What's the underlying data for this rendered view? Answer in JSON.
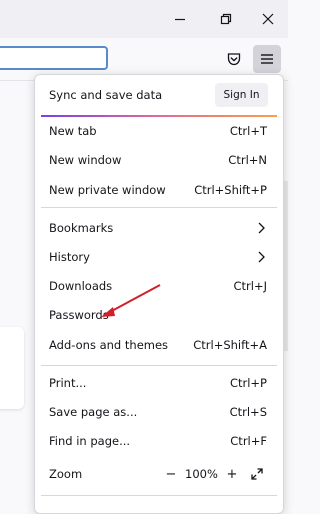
{
  "window": {
    "controls": {
      "restore_icon": "restore-icon",
      "close_icon": "close-icon"
    }
  },
  "toolbar": {
    "pocket_icon": "pocket-icon",
    "menu_icon": "hamburger-menu-icon"
  },
  "menu": {
    "sync": {
      "label": "Sync and save data",
      "button": "Sign In"
    },
    "groups": [
      [
        {
          "label": "New tab",
          "shortcut": "Ctrl+T"
        },
        {
          "label": "New window",
          "shortcut": "Ctrl+N"
        },
        {
          "label": "New private window",
          "shortcut": "Ctrl+Shift+P"
        }
      ],
      [
        {
          "label": "Bookmarks",
          "submenu": true
        },
        {
          "label": "History",
          "submenu": true
        },
        {
          "label": "Downloads",
          "shortcut": "Ctrl+J"
        },
        {
          "label": "Passwords"
        },
        {
          "label": "Add-ons and themes",
          "shortcut": "Ctrl+Shift+A"
        }
      ],
      [
        {
          "label": "Print...",
          "shortcut": "Ctrl+P"
        },
        {
          "label": "Save page as...",
          "shortcut": "Ctrl+S"
        },
        {
          "label": "Find in page...",
          "shortcut": "Ctrl+F"
        }
      ]
    ],
    "zoom": {
      "label": "Zoom",
      "minus": "−",
      "value": "100%",
      "plus": "+",
      "fullscreen_icon": "fullscreen-icon"
    }
  },
  "annotation": {
    "color": "#d0202a",
    "target": "Passwords"
  }
}
